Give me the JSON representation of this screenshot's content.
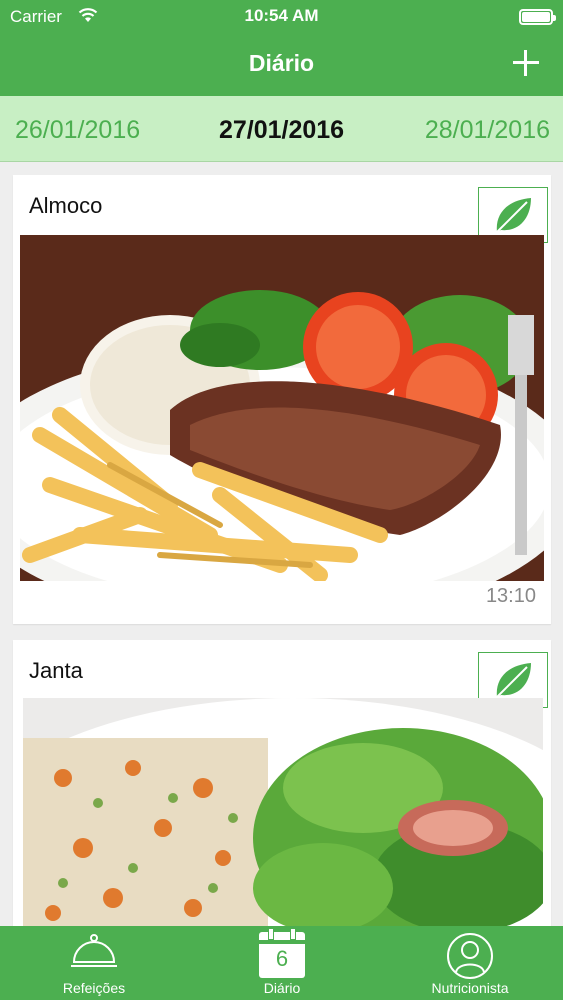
{
  "status_bar": {
    "carrier": "Carrier",
    "time": "10:54 AM"
  },
  "nav": {
    "title": "Diário",
    "add_icon": "plus-icon"
  },
  "dates": {
    "prev": "26/01/2016",
    "current": "27/01/2016",
    "next": "28/01/2016"
  },
  "meals": [
    {
      "title": "Almoco",
      "time": "13:10",
      "icon": "leaf-icon"
    },
    {
      "title": "Janta",
      "icon": "leaf-icon"
    }
  ],
  "tabs": [
    {
      "label": "Refeições",
      "icon": "cloche-icon"
    },
    {
      "label": "Diário",
      "icon": "calendar-icon",
      "day": "6"
    },
    {
      "label": "Nutricionista",
      "icon": "person-icon"
    }
  ],
  "colors": {
    "primary": "#4caf50",
    "date_bar": "#c8efc4",
    "background": "#eeeeee"
  }
}
